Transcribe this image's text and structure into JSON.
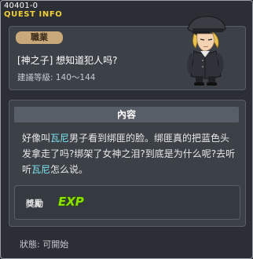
{
  "window": {
    "quest_id": "40401-0",
    "title": "QUEST INFO"
  },
  "info": {
    "job_badge": "職業",
    "quest_name": "[神之子] 想知道犯人吗?",
    "level_requirement": "建議等級: 140～144"
  },
  "npc": {
    "icon": "npc-portrait-officer"
  },
  "content": {
    "header": "內容",
    "text_parts": {
      "p1": "好像叫",
      "p2": "瓦尼",
      "p3": "男子看到绑匪的脸。绑匪真的把蓝色头发拿走了吗?绑架了女神之泪?到底是为什么呢?去听听",
      "p4": "瓦尼",
      "p5": "怎么说。"
    },
    "npc_name_color": "#7ee3ef",
    "reward": {
      "label": "獎勵",
      "item": "EXP"
    }
  },
  "status": "狀態: 可開始"
}
